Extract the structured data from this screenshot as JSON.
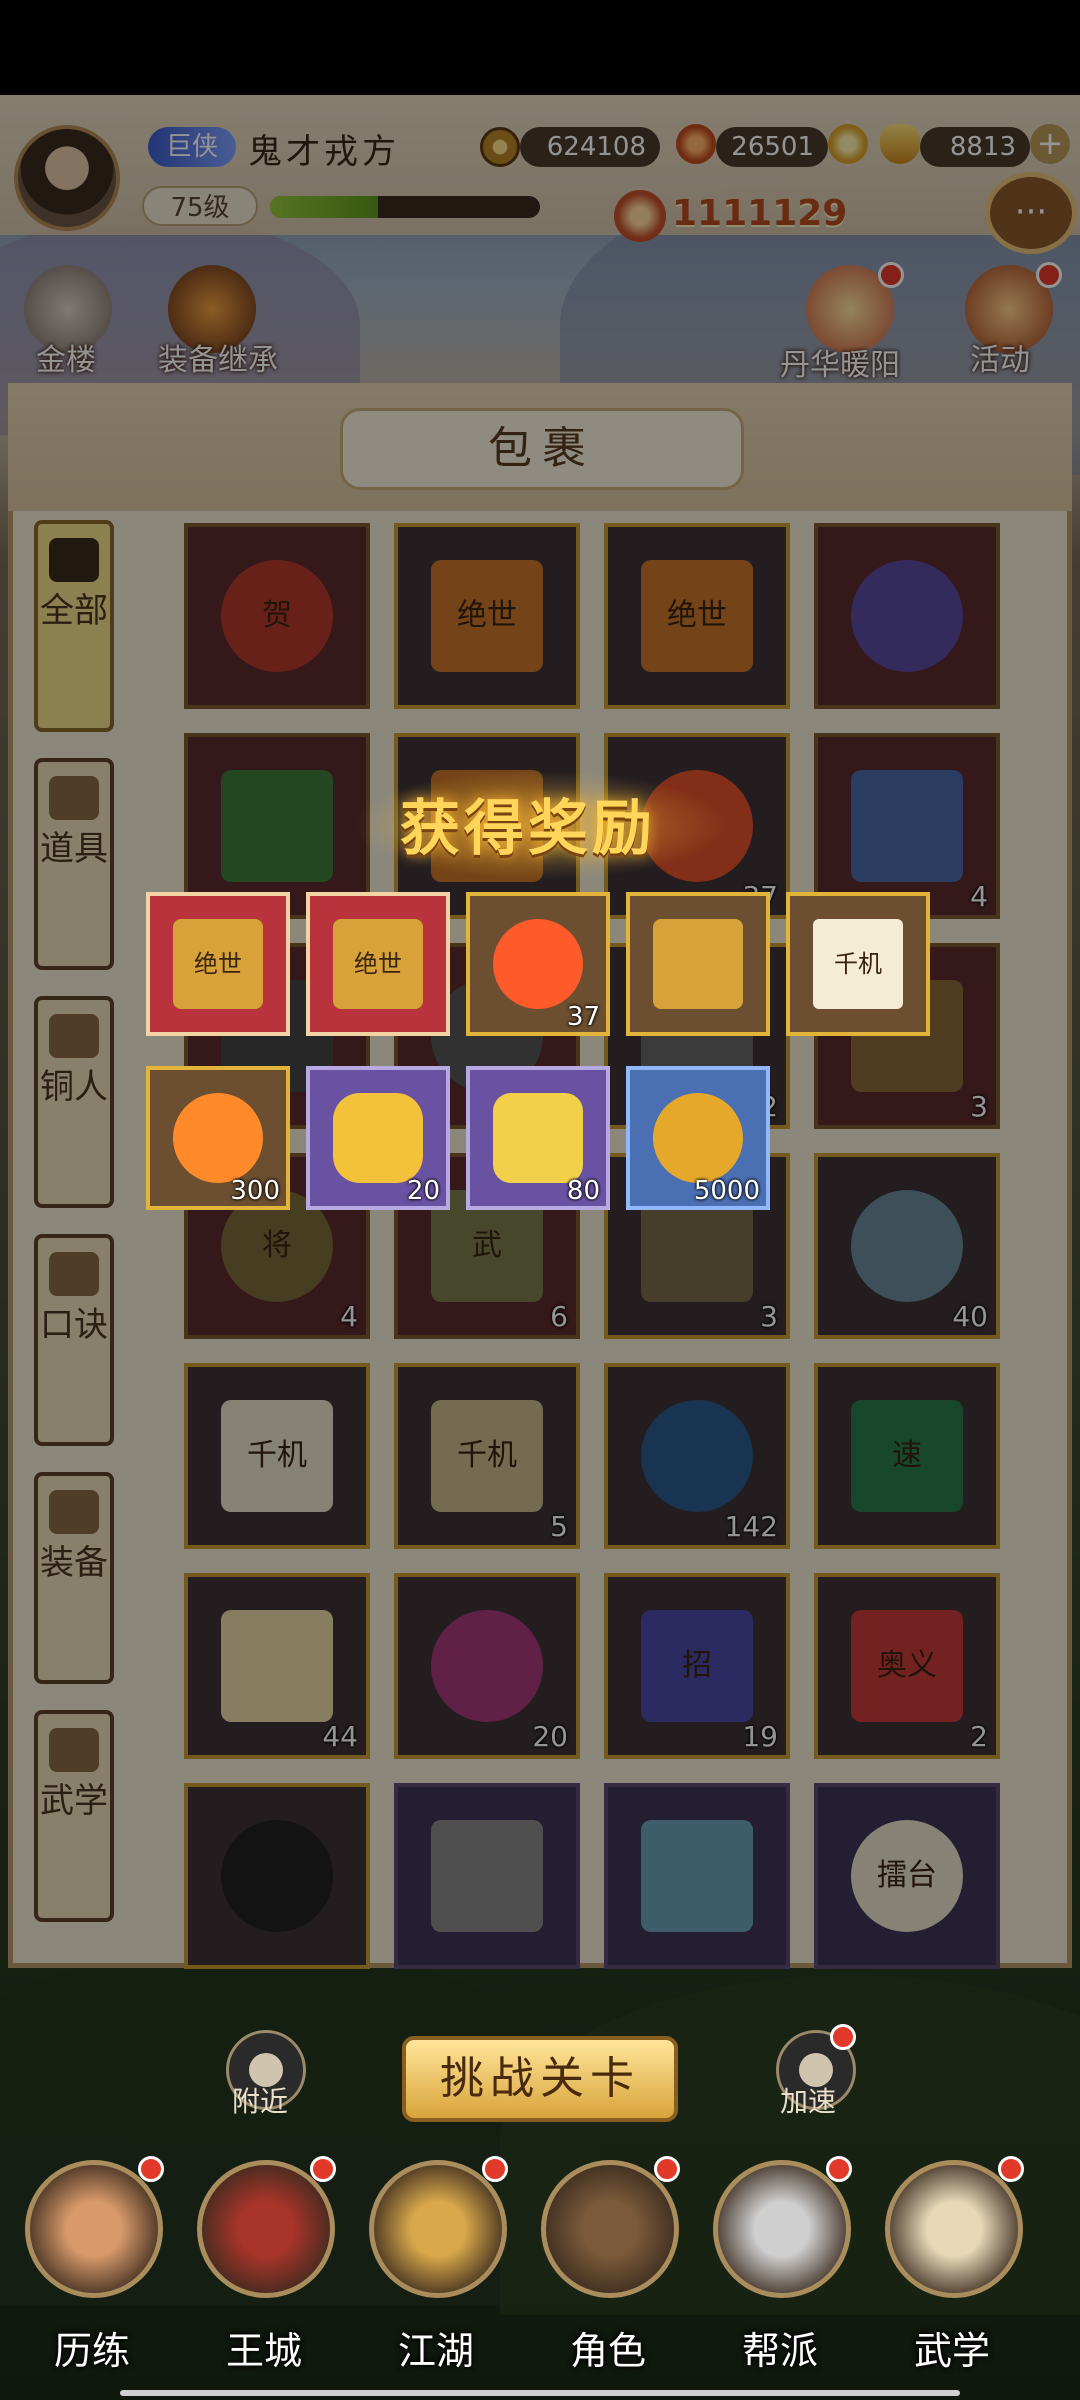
{
  "player": {
    "rank": "巨侠",
    "name": "鬼才戎方",
    "level": "75级",
    "exp_fraction": 0.4,
    "power": "1111129"
  },
  "currency": {
    "coins": "624108",
    "flame": "26501",
    "gold": "8813"
  },
  "top_icons": [
    {
      "label": "金楼"
    },
    {
      "label": "装备继承"
    },
    {
      "label": "丹华暖阳"
    },
    {
      "label": "活动"
    }
  ],
  "bag": {
    "title": "包裹",
    "tabs": [
      {
        "label": "全部"
      },
      {
        "label": "道具"
      },
      {
        "label": "铜人"
      },
      {
        "label": "口诀"
      },
      {
        "label": "装备"
      },
      {
        "label": "武学"
      }
    ],
    "items": [
      {
        "label": "贺",
        "count": ""
      },
      {
        "label": "绝世",
        "count": ""
      },
      {
        "label": "绝世",
        "count": ""
      },
      {
        "label": "",
        "count": ""
      },
      {
        "label": "",
        "count": ""
      },
      {
        "label": "",
        "count": ""
      },
      {
        "label": "",
        "count": "37"
      },
      {
        "label": "",
        "count": "4"
      },
      {
        "label": "",
        "count": ""
      },
      {
        "label": "",
        "count": ""
      },
      {
        "label": "",
        "count": "2"
      },
      {
        "label": "",
        "count": "3"
      },
      {
        "label": "将",
        "count": "4"
      },
      {
        "label": "武",
        "count": "6"
      },
      {
        "label": "",
        "count": "3"
      },
      {
        "label": "",
        "count": "40"
      },
      {
        "label": "千机",
        "count": ""
      },
      {
        "label": "千机",
        "count": "5"
      },
      {
        "label": "",
        "count": "142"
      },
      {
        "label": "速",
        "count": ""
      },
      {
        "label": "",
        "count": "44"
      },
      {
        "label": "",
        "count": "20"
      },
      {
        "label": "招",
        "count": "19"
      },
      {
        "label": "奥义",
        "count": "2"
      },
      {
        "label": "",
        "count": ""
      },
      {
        "label": "",
        "count": ""
      },
      {
        "label": "",
        "count": ""
      },
      {
        "label": "擂台",
        "count": ""
      }
    ]
  },
  "reward": {
    "title": "获得奖励",
    "items": [
      {
        "label": "绝世",
        "count": ""
      },
      {
        "label": "绝世",
        "count": ""
      },
      {
        "label": "",
        "count": "37"
      },
      {
        "label": "",
        "count": ""
      },
      {
        "label": "千机",
        "count": ""
      },
      {
        "label": "",
        "count": "300"
      },
      {
        "label": "",
        "count": "20"
      },
      {
        "label": "",
        "count": "80"
      },
      {
        "label": "",
        "count": "5000"
      }
    ]
  },
  "bottom": {
    "challenge": "挑战关卡",
    "nearby": "附近",
    "speedup": "加速",
    "nav": [
      {
        "label": "历练"
      },
      {
        "label": "王城"
      },
      {
        "label": "江湖"
      },
      {
        "label": "角色"
      },
      {
        "label": "帮派"
      },
      {
        "label": "武学"
      }
    ]
  },
  "colors": {
    "accent_gold": "#e3b43a",
    "panel_bg": "#f1e9d5",
    "badge_red": "#e23a2a"
  }
}
